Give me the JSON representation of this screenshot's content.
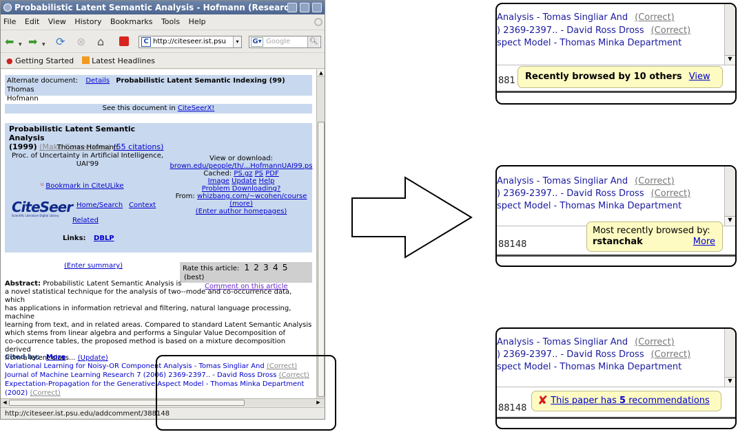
{
  "browser": {
    "title": "Probabilistic Latent Semantic Analysis - Hofmann (ResearchI",
    "menu": [
      "File",
      "Edit",
      "View",
      "History",
      "Bookmarks",
      "Tools",
      "Help"
    ],
    "url": "http://citeseer.ist.psu",
    "search_placeholder": "Google",
    "bookmarks": [
      "Getting Started",
      "Latest Headlines"
    ],
    "status": "http://citeseer.ist.psu.edu/addcomment/388148"
  },
  "page": {
    "alternate_label": "Alternate document:",
    "alternate_details": "Details",
    "alternate_title": "Probabilistic Latent Semantic Indexing (99)",
    "alternate_author_1": "Thomas",
    "alternate_author_2": "Hofmann",
    "see_doc_prefix": "See this document in",
    "see_doc_link": "CiteSeerX!",
    "paper_title": "Probabilistic Latent Semantic Analysis",
    "year": "(1999)",
    "make_corrections": "(Make Corrections)",
    "citations": "(55 citations)",
    "author": "Thomas Hofmann",
    "venue_1": "Proc. of Uncertainty in Artificial Intelligence,",
    "venue_2": "UAI'99",
    "bookmark_citeulike": "Bookmark in CiteULike",
    "logo": "CiteSeer",
    "logo_sub": "Scientific Literature Digital Library",
    "home_search": "Home/Search",
    "context": "Context",
    "related": "Related",
    "links_label": "Links:",
    "dblp": "DBLP",
    "view_download": "View or download:",
    "download_link": "brown.edu/people/th/...HofmannUAI99.ps",
    "cached_label": "Cached:",
    "cached_ps_gz": "PS.gz",
    "cached_ps": "PS",
    "cached_pdf": "PDF",
    "image": "Image",
    "update": "Update",
    "help": "Help",
    "problem_downloading": "Problem Downloading?",
    "from_label": "From:",
    "from_link": "whizbang.com/~wcohen/course",
    "more": "(more)",
    "enter_homepages": "(Enter author homepages)",
    "enter_summary": "(Enter summary)",
    "rate_label": "Rate this article:",
    "rate_values": [
      "1",
      "2",
      "3",
      "4",
      "5"
    ],
    "rate_best": "(best)",
    "comment_link": "Comment on this article",
    "abstract_label": "Abstract:",
    "abstract_lines": [
      "Probabilistic Latent Semantic Analysis is",
      "a novel statistical technique for the analysis of two--mode and co-occurrence data, which",
      "has applications in information retrieval and filtering, natural language processing, machine",
      "learning from text, and in related areas. Compared to standard Latent Semantic Analysis",
      "which stems from linear algebra and performs a Singular Value Decomposition of",
      "co-occurrence tables, the proposed method is based on a mixture decomposition derived",
      "from a latent class..."
    ],
    "abstract_update": "(Update)",
    "cited_by_label": "Cited by:",
    "cited_more": "More",
    "cited": [
      {
        "text": "Variational Learning for Noisy-OR Component Analysis - Tomas Singliar And",
        "correct": "(Correct)"
      },
      {
        "text": "Journal of Machine Learning Research 7 (2006) 2369-2397.. - David Ross Dross",
        "correct": "(Correct)"
      },
      {
        "text": "Expectation-Propagation for the Generative Aspect Model - Thomas Minka Department",
        "correct": ""
      },
      {
        "text": "(2002)",
        "correct": "(Correct)"
      }
    ]
  },
  "zoom": {
    "line1": "Analysis - Tomas Singliar And",
    "line2": ") 2369-2397.. - David Ross Dross",
    "line3": "spect Model - Thomas Minka Department",
    "correct": "(Correct)",
    "status_num_1": "881",
    "status_num": "88148",
    "panel1": {
      "text": "Recently browsed by 10 others",
      "link": "View"
    },
    "panel2": {
      "text": "Most recently browsed by:",
      "user": "rstanchak",
      "link": "More"
    },
    "panel3": {
      "prefix": "This paper has",
      "count": "5",
      "suffix": "recommendations"
    }
  },
  "colors": {
    "link": "#0000cc",
    "blue_box": "#c8d8ee",
    "bubble": "#fefbc2"
  }
}
